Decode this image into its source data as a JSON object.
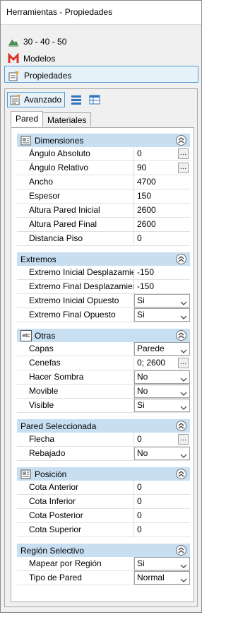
{
  "window": {
    "title": "Herramientas - Propiedades"
  },
  "nav": {
    "items": [
      {
        "label": "30 - 40 - 50"
      },
      {
        "label": "Modelos"
      },
      {
        "label": "Propiedades"
      }
    ]
  },
  "toolbar": {
    "advanced_label": "Avanzado"
  },
  "tabs": [
    {
      "label": "Pared"
    },
    {
      "label": "Materiales"
    }
  ],
  "sections": {
    "dimensiones": {
      "title": "Dimensiones",
      "rows": [
        {
          "name": "Ángulo Absoluto",
          "value": "0"
        },
        {
          "name": "Ángulo Relativo",
          "value": "90"
        },
        {
          "name": "Ancho",
          "value": "4700"
        },
        {
          "name": "Espesor",
          "value": "150"
        },
        {
          "name": "Altura Pared Inicial",
          "value": "2600"
        },
        {
          "name": "Altura Pared Final",
          "value": "2600"
        },
        {
          "name": "Distancia Piso",
          "value": "0"
        }
      ]
    },
    "extremos": {
      "title": "Extremos",
      "rows": [
        {
          "name": "Extremo Inicial Desplazamiento",
          "value": "-150"
        },
        {
          "name": "Extremo Final Desplazamiento",
          "value": "-150"
        },
        {
          "name": "Extremo Inicial Opuesto",
          "value": "Si"
        },
        {
          "name": "Extremo Final Opuesto",
          "value": "Si"
        }
      ]
    },
    "otras": {
      "title": "Otras",
      "icon_text": "etc",
      "rows": [
        {
          "name": "Capas",
          "value": "Parede"
        },
        {
          "name": "Cenefas",
          "value": "0; 2600"
        },
        {
          "name": "Hacer Sombra",
          "value": "No"
        },
        {
          "name": "Movible",
          "value": "No"
        },
        {
          "name": "Visible",
          "value": "Si"
        }
      ]
    },
    "pared_seleccionada": {
      "title": "Pared Seleccionada",
      "rows": [
        {
          "name": "Flecha",
          "value": "0"
        },
        {
          "name": "Rebajado",
          "value": "No"
        }
      ]
    },
    "posicion": {
      "title": "Posición",
      "rows": [
        {
          "name": "Cota Anterior",
          "value": "0"
        },
        {
          "name": "Cota Inferior",
          "value": "0"
        },
        {
          "name": "Cota Posterior",
          "value": "0"
        },
        {
          "name": "Cota Superior",
          "value": "0"
        }
      ]
    },
    "region_selectivo": {
      "title": "Región Selectivo",
      "rows": [
        {
          "name": "Mapear por Región",
          "value": "Si"
        },
        {
          "name": "Tipo de Pared",
          "value": "Normal"
        }
      ]
    }
  },
  "colors": {
    "section_header": "#c8dff2",
    "selection_border": "#4e9ad6",
    "selection_fill": "#e6f2fa"
  }
}
